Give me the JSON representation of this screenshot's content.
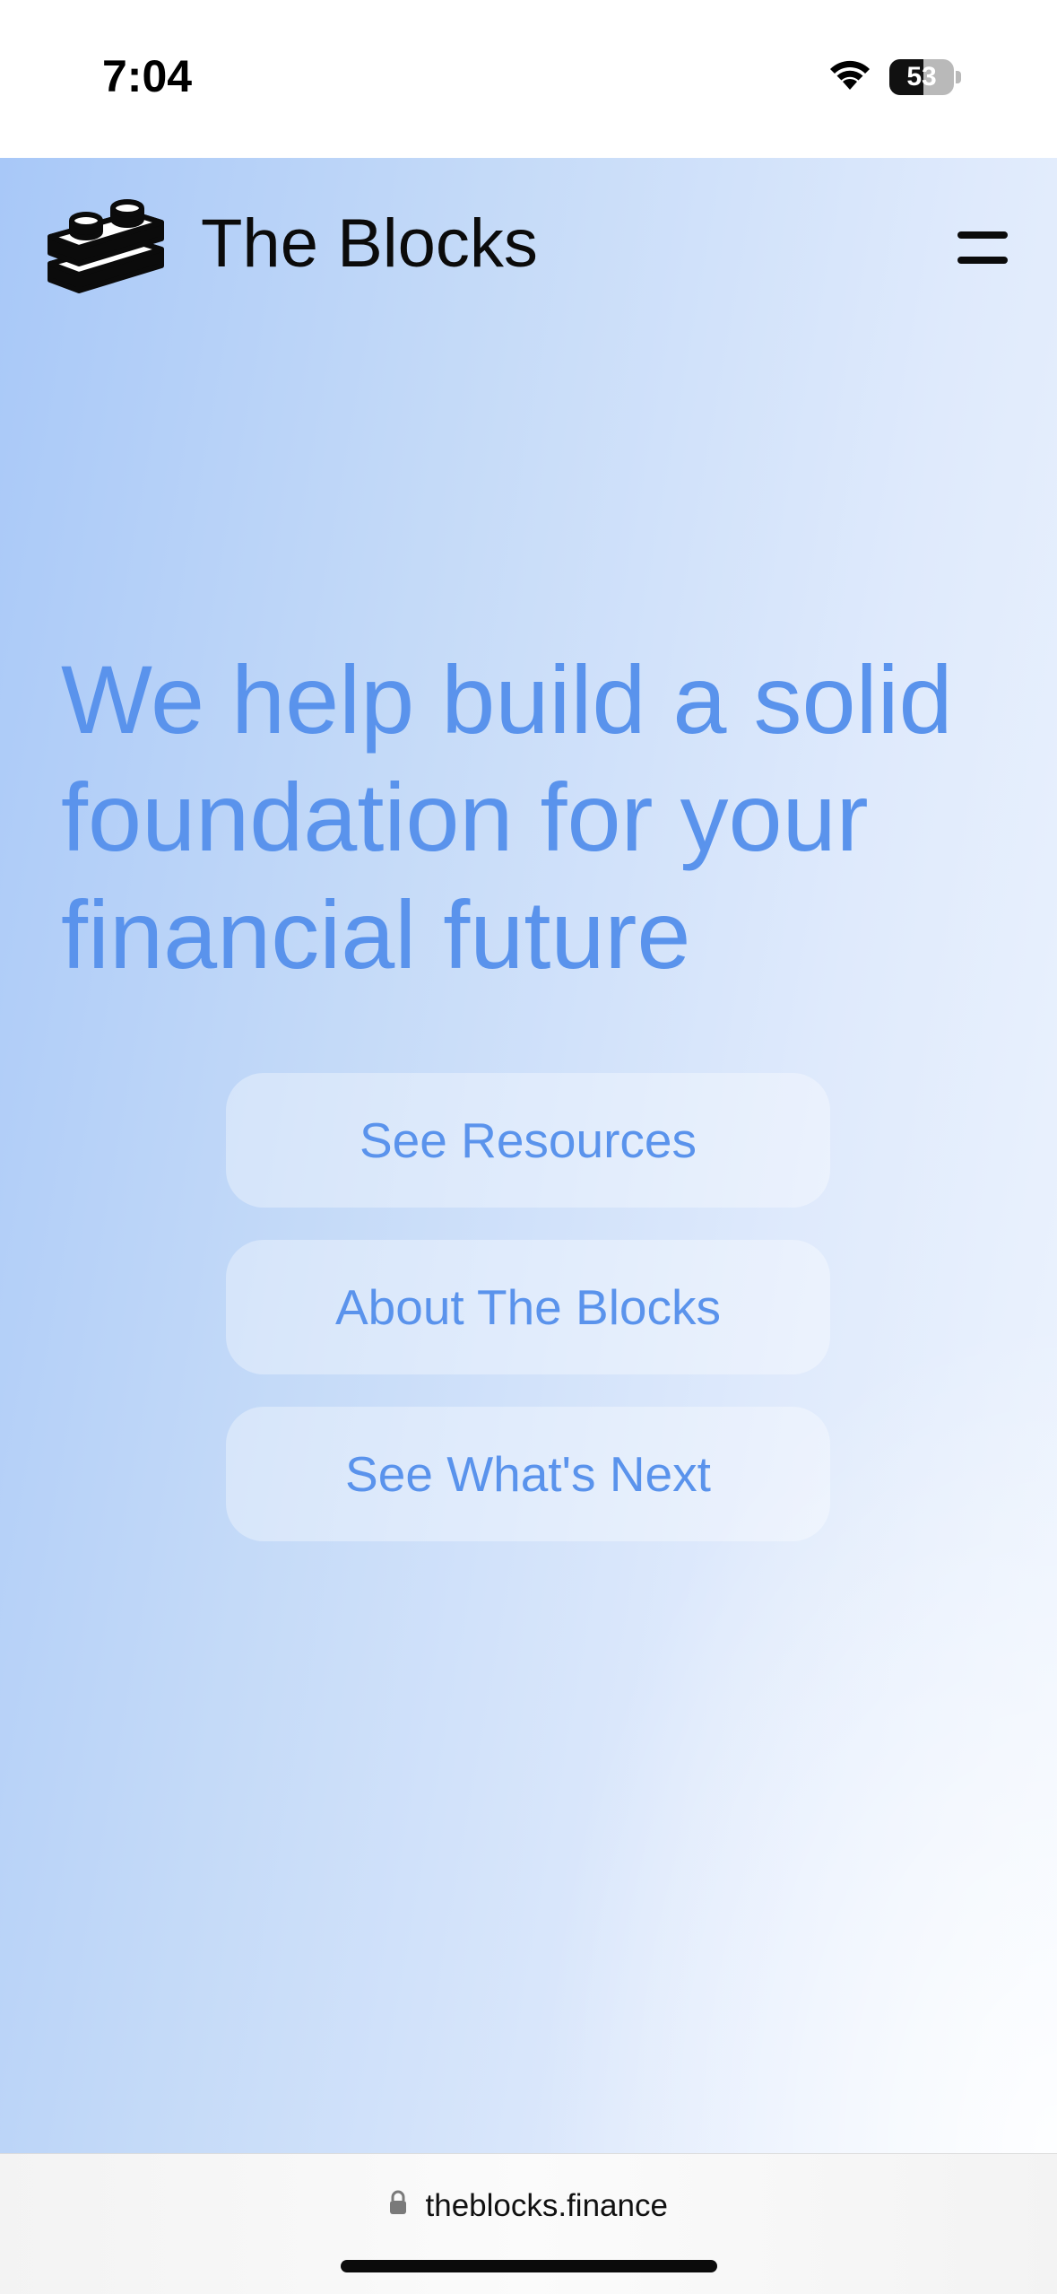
{
  "status_bar": {
    "time": "7:04",
    "battery_level": "53",
    "battery_fraction": 0.53,
    "icons": [
      "wifi-icon",
      "battery-icon"
    ]
  },
  "site": {
    "brand": "The Blocks",
    "logo_icon": "lego-bricks-icon",
    "menu_icon": "hamburger-menu-icon"
  },
  "hero": {
    "heading": "We help build a solid foundation for your financial future"
  },
  "buttons": [
    {
      "label": "See Resources"
    },
    {
      "label": "About The Blocks"
    },
    {
      "label": "See What's Next"
    }
  ],
  "browser": {
    "url": "theblocks.finance",
    "lock_icon": "lock-icon"
  },
  "colors": {
    "accent": "#5a93ec",
    "gradient_start": "#a8c8f8",
    "gradient_end": "#eff5fe",
    "text_dark": "#0b0b0b"
  }
}
